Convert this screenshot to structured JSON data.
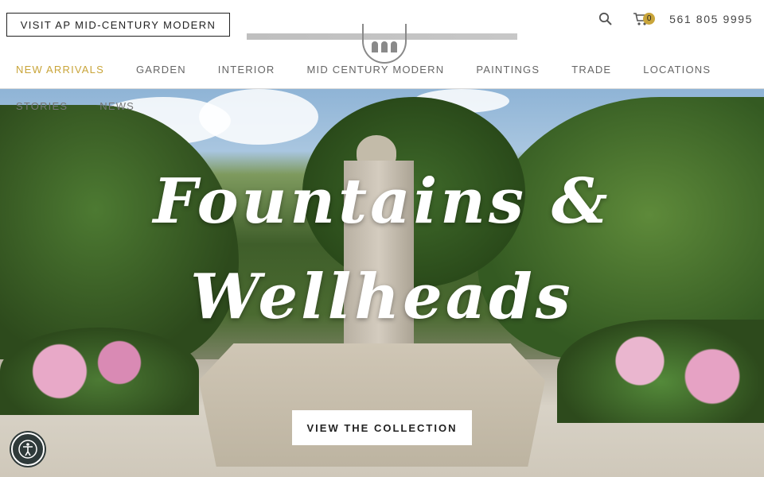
{
  "header": {
    "visit_label": "VISIT AP MID-CENTURY MODERN",
    "phone": "561 805 9995",
    "cart_count": "0",
    "icons": {
      "search": "search-icon",
      "cart": "cart-icon"
    }
  },
  "nav": {
    "items": [
      {
        "label": "NEW ARRIVALS",
        "active": true
      },
      {
        "label": "GARDEN"
      },
      {
        "label": "INTERIOR"
      },
      {
        "label": "MID CENTURY MODERN"
      },
      {
        "label": "PAINTINGS"
      },
      {
        "label": "TRADE"
      },
      {
        "label": "LOCATIONS"
      }
    ],
    "secondary": [
      {
        "label": "STORIES"
      },
      {
        "label": "NEWS"
      }
    ]
  },
  "hero": {
    "title_line1": "Fountains &",
    "title_line2": "Wellheads",
    "cta_label": "VIEW THE COLLECTION"
  },
  "colors": {
    "accent": "#c9a53a",
    "text": "#222222",
    "nav": "#666666"
  },
  "accessibility": {
    "icon": "accessibility-icon"
  }
}
